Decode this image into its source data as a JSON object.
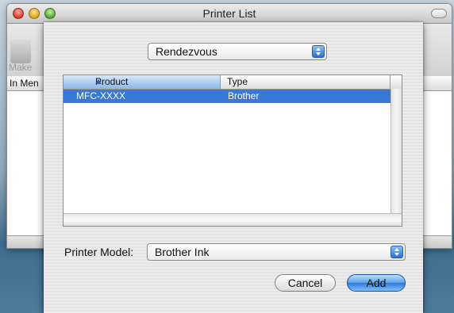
{
  "window": {
    "title": "Printer List",
    "toolbar_label": "Make",
    "column_header": "In Men"
  },
  "sheet": {
    "connection_popup": {
      "selected": "Rendezvous"
    },
    "printer_list": {
      "columns": [
        "Product",
        "Type"
      ],
      "rows": [
        {
          "product": "MFC-XXXX",
          "type": "Brother",
          "selected": true
        }
      ]
    },
    "printer_model": {
      "label": "Printer Model:",
      "selected": "Brother Ink"
    },
    "buttons": {
      "cancel": "Cancel",
      "add": "Add"
    }
  },
  "colors": {
    "selection": "#3a78d6",
    "default_button": "#2f78d6"
  },
  "icons": [
    "close-light-icon",
    "minimize-light-icon",
    "zoom-light-icon",
    "toolbar-toggle-icon",
    "sort-ascending-icon",
    "popup-arrows-icon"
  ]
}
